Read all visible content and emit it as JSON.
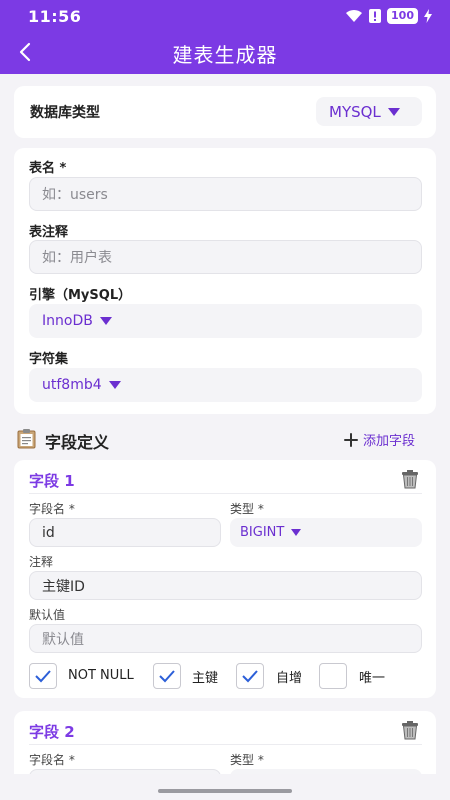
{
  "status": {
    "time": "11:56",
    "battery": "100"
  },
  "app": {
    "title": "建表生成器"
  },
  "db": {
    "label": "数据库类型",
    "value": "MYSQL"
  },
  "table": {
    "name_label": "表名 *",
    "name_placeholder": "如：users",
    "comment_label": "表注释",
    "comment_placeholder": "如：用户表",
    "engine_label": "引擎（MySQL）",
    "engine_value": "InnoDB",
    "charset_label": "字符集",
    "charset_value": "utf8mb4"
  },
  "fields_section": {
    "title": "字段定义",
    "add_label": "添加字段"
  },
  "fields": [
    {
      "title": "字段 1",
      "name_label": "字段名 *",
      "name_value": "id",
      "type_label": "类型 *",
      "type_value": "BIGINT",
      "comment_label": "注释",
      "comment_value": "主键ID",
      "default_label": "默认值",
      "default_placeholder": "默认值",
      "checks": [
        {
          "label": "NOT NULL",
          "checked": true
        },
        {
          "label": "主键",
          "checked": true
        },
        {
          "label": "自增",
          "checked": true
        },
        {
          "label": "唯一",
          "checked": false
        }
      ]
    },
    {
      "title": "字段 2",
      "name_label": "字段名 *",
      "type_label": "类型 *"
    }
  ],
  "colors": {
    "accent": "#7c3ae4",
    "select_text": "#6b2fd0"
  },
  "icons": [
    "back-arrow-icon",
    "wifi-icon",
    "alert-icon",
    "battery-icon",
    "bolt-icon",
    "clipboard-icon",
    "plus-icon",
    "trash-icon",
    "checkmark-icon",
    "dropdown-triangle-icon"
  ]
}
